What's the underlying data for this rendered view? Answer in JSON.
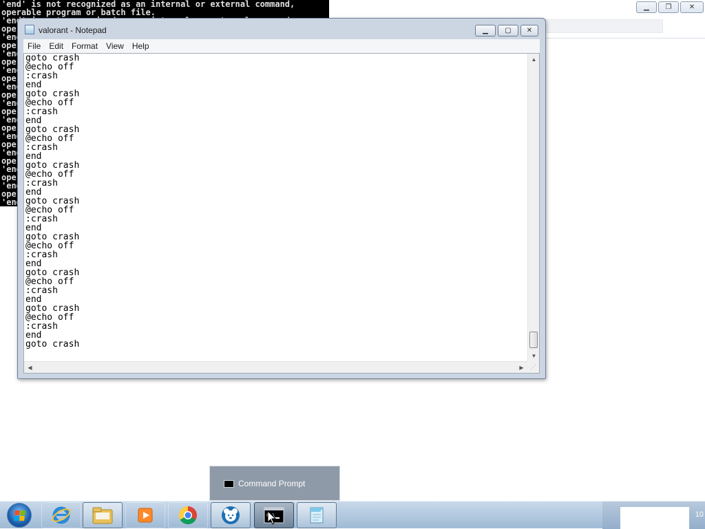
{
  "command_prompt": {
    "lines": [
      "'end' is not recognized as an internal or external command,",
      "operable program or batch file.",
      "'end' is not recognized as an internal or external command,",
      "operable program or batch file.",
      "'end' is not recognized as an internal or external command,",
      "operable program or batch file.",
      "'end' is not recognized as an internal or external command,",
      "operable program or batch file.",
      "'end' is not recognized as an internal or external command,",
      "operable program or batch file.",
      "'end' is not recognized as an internal or external command,",
      "operable program or batch file.",
      "'end' is not recognized as an internal or external command,",
      "operable program or batch file.",
      "'end' is not recognized as an internal or external command,",
      "operable program or batch file.",
      "'end' is not recognized as an internal or external command,",
      "operable program or batch file.",
      "'end' is not recognized as an internal or external command,",
      "operable program or batch file.",
      "'end' is not recognized as an internal or external command,",
      "operable program or batch file.",
      "'end' is not recognized as an internal or external command,",
      "operable program or batch file.",
      "'end' is not recognized as an internal or external command,"
    ]
  },
  "background_window": {
    "minimize_glyph": "▁",
    "restore_glyph": "❐",
    "close_glyph": "✕"
  },
  "notepad": {
    "title": "valorant - Notepad",
    "caption_buttons": {
      "minimize": "▁",
      "maximize": "▢",
      "close": "✕"
    },
    "menu": [
      "File",
      "Edit",
      "Format",
      "View",
      "Help"
    ],
    "lines": [
      "goto crash",
      "@echo off",
      ":crash",
      "end",
      "goto crash",
      "@echo off",
      ":crash",
      "end",
      "goto crash",
      "@echo off",
      ":crash",
      "end",
      "goto crash",
      "@echo off",
      ":crash",
      "end",
      "goto crash",
      "@echo off",
      ":crash",
      "end",
      "goto crash",
      "@echo off",
      ":crash",
      "end",
      "goto crash",
      "@echo off",
      ":crash",
      "end",
      "goto crash",
      "@echo off",
      ":crash",
      "end",
      "goto crash"
    ],
    "scroll": {
      "up_arrow": "▲",
      "down_arrow": "▼",
      "left_arrow": "◀",
      "right_arrow": "▶",
      "grip": "⋰"
    }
  },
  "taskbar_thumbnail": {
    "label": "Command Prompt",
    "icon": "command-prompt-icon"
  },
  "taskbar": {
    "start_icon": "windows-start-icon",
    "buttons": [
      {
        "name": "internet-explorer",
        "icon": "internet-explorer-icon",
        "state": "pinned"
      },
      {
        "name": "file-explorer",
        "icon": "folder-icon",
        "state": "running"
      },
      {
        "name": "media-player",
        "icon": "media-player-icon",
        "state": "pinned"
      },
      {
        "name": "chrome",
        "icon": "chrome-icon",
        "state": "pinned"
      },
      {
        "name": "bear-app",
        "icon": "bear-icon",
        "state": "running"
      },
      {
        "name": "command-prompt",
        "icon": "command-prompt-icon",
        "state": "active"
      },
      {
        "name": "notepad",
        "icon": "notepad-icon",
        "state": "running"
      }
    ],
    "clock_fragment": "10"
  },
  "colors": {
    "console_bg": "#000000",
    "console_fg": "#e0e0e0",
    "taskbar_top": "#c9d9ea",
    "taskbar_bottom": "#9fbad5",
    "popup_bg": "#8e9aa8"
  }
}
